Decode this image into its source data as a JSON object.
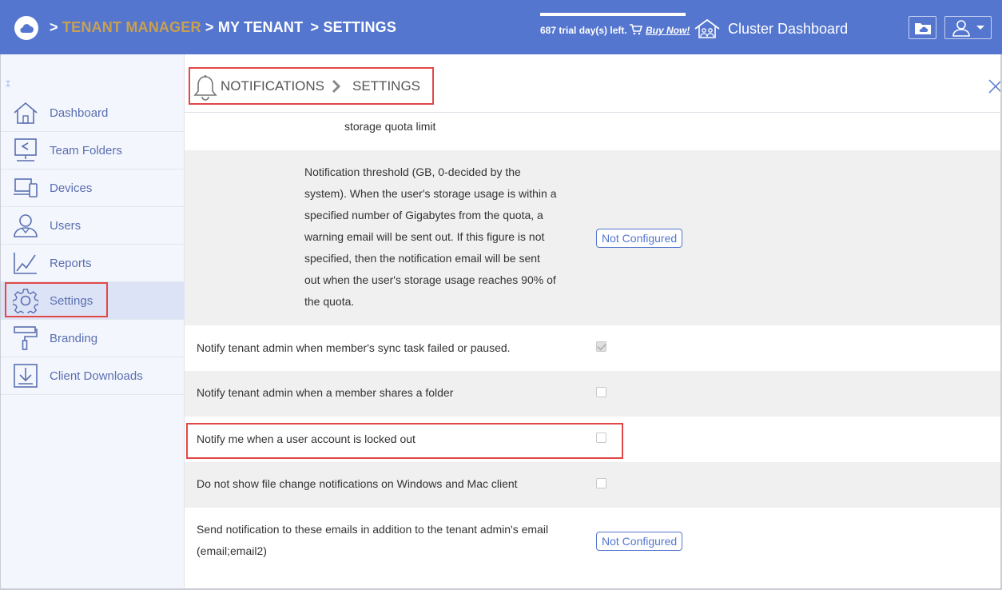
{
  "topbar": {
    "crumb_sep": ">",
    "crumb_tenant_manager": "TENANT MANAGER",
    "crumb_my_tenant": "MY TENANT",
    "crumb_settings": "SETTINGS",
    "trial_text": "687 trial day(s) left.",
    "buy_now": "Buy Now!",
    "cluster_dashboard": "Cluster Dashboard",
    "brand_color": "#5476cf",
    "highlight_color": "#c9a050"
  },
  "sidebar": {
    "collapse_glyph": "⌶",
    "items": [
      {
        "label": "Dashboard",
        "icon": "home-icon"
      },
      {
        "label": "Team Folders",
        "icon": "team-folder-icon"
      },
      {
        "label": "Devices",
        "icon": "devices-icon"
      },
      {
        "label": "Users",
        "icon": "user-icon"
      },
      {
        "label": "Reports",
        "icon": "chart-icon"
      },
      {
        "label": "Settings",
        "icon": "gear-icon",
        "active": true
      },
      {
        "label": "Branding",
        "icon": "paint-roller-icon"
      },
      {
        "label": "Client Downloads",
        "icon": "download-icon"
      }
    ]
  },
  "header": {
    "title": "NOTIFICATIONS",
    "subtitle": "SETTINGS"
  },
  "settings": {
    "partial_text": "storage quota limit",
    "threshold_lines": [
      "Notification threshold (GB, 0-decided by the",
      "system). When the user's storage usage is within a",
      "specified number of Gigabytes from the quota, a",
      "warning email will be sent out. If this figure is not",
      "specified, then the notification email will be sent",
      "out when the user's storage usage reaches 90% of",
      "the quota."
    ],
    "threshold_value": "Not Configured",
    "notify_sync_failed": "Notify tenant admin when member's sync task failed or paused.",
    "notify_sync_failed_checked": true,
    "notify_share_folder": "Notify tenant admin when a member shares a folder",
    "notify_share_folder_checked": false,
    "notify_locked_out": "Notify me when a user account is locked out",
    "notify_locked_out_checked": false,
    "hide_file_change": "Do not show file change notifications on Windows and Mac client",
    "hide_file_change_checked": false,
    "extra_emails_line1": "Send notification to these emails in addition to the tenant admin's email",
    "extra_emails_line2": "(email;email2)",
    "extra_emails_value": "Not Configured"
  }
}
